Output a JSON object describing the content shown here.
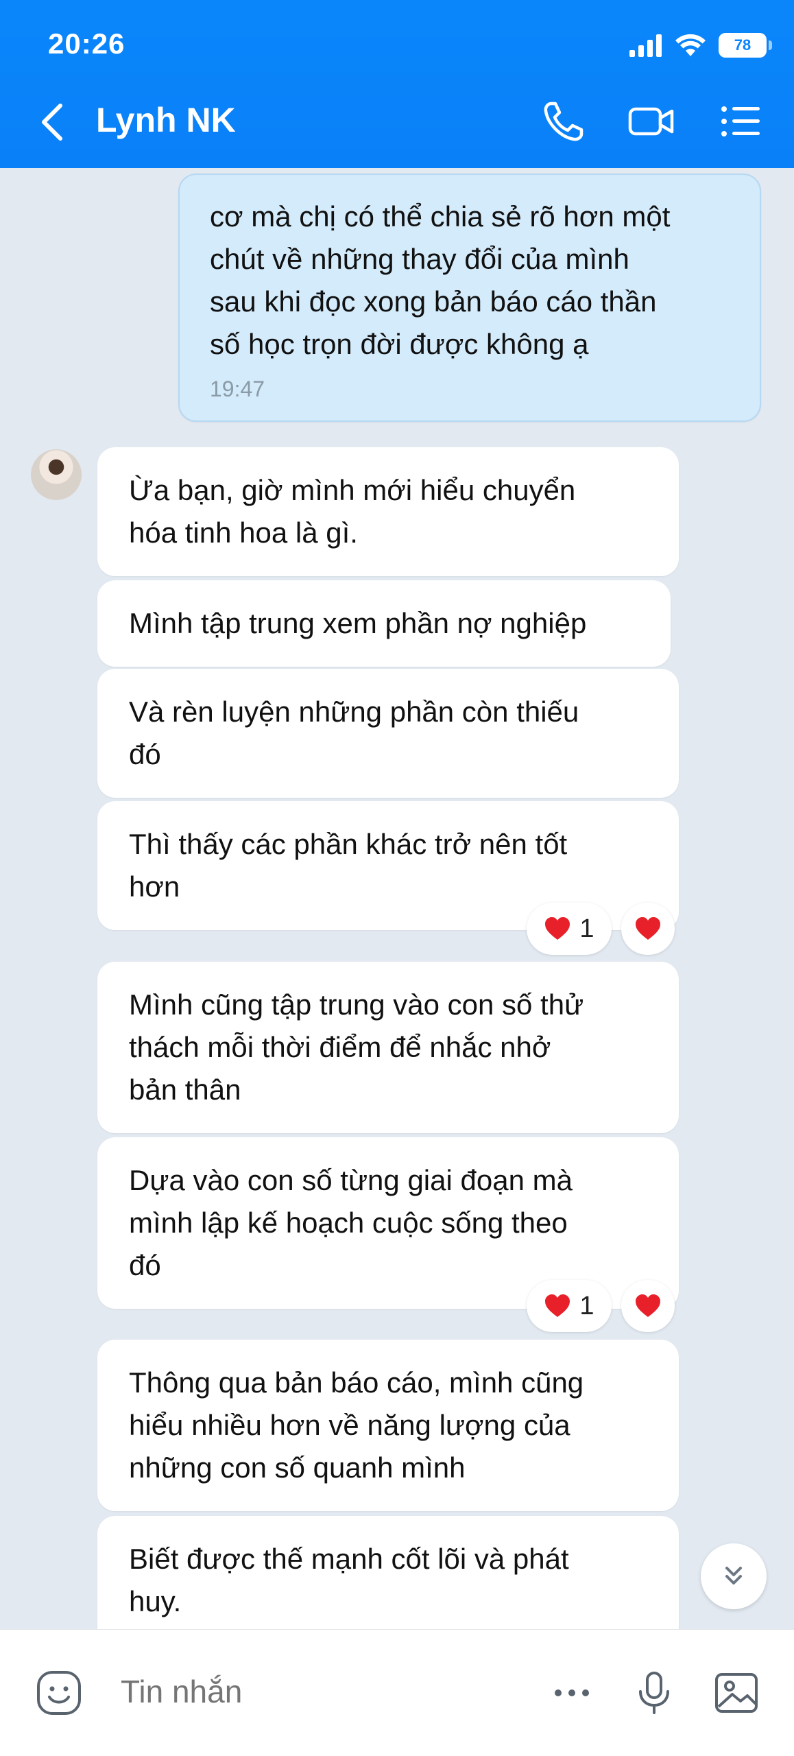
{
  "status_bar": {
    "time": "20:26",
    "battery": "78"
  },
  "header": {
    "title": "Lynh NK",
    "icons": [
      "back-arrow-icon",
      "phone-icon",
      "video-call-icon",
      "menu-list-icon"
    ]
  },
  "outgoing": {
    "lines": [
      "cơ mà chị có thể chia sẻ rõ hơn một",
      "chút về những thay đổi của mình",
      "sau khi đọc xong bản báo cáo thần",
      "số học trọn đời được không ạ"
    ],
    "time": "19:47"
  },
  "incoming": [
    {
      "lines": [
        "Ừa bạn, giờ mình mới hiểu chuyển",
        "hóa tinh hoa là gì."
      ]
    },
    {
      "lines": [
        "Mình tập trung xem phần nợ nghiệp"
      ]
    },
    {
      "lines": [
        "Và rèn luyện những phần còn thiếu",
        "đó"
      ]
    },
    {
      "lines": [
        "Thì thấy các phần khác trở nên tốt",
        "hơn"
      ],
      "reaction_count": "1"
    },
    {
      "lines": [
        "Mình cũng tập trung vào con số thử",
        "thách mỗi thời điểm để nhắc nhở",
        "bản thân"
      ]
    },
    {
      "lines": [
        "Dựa vào con số từng giai đoạn mà",
        "mình lập kế hoạch cuộc sống theo",
        "đó"
      ],
      "reaction_count": "1"
    },
    {
      "lines": [
        "Thông qua bản báo cáo, mình cũng",
        "hiểu nhiều hơn về năng lượng của",
        "những con số quanh mình"
      ]
    },
    {
      "lines": [
        "Biết được thế mạnh cốt lõi và phát",
        "huy."
      ]
    }
  ],
  "composer": {
    "placeholder": "Tin nhắn",
    "icons": [
      "sticker-icon",
      "more-icon",
      "microphone-icon",
      "image-icon"
    ]
  },
  "colors": {
    "header": "#0a84ff",
    "chat_bg": "#e2e9f1",
    "outgoing_bubble": "#d4ebfb",
    "reaction_heart": "#e8202a"
  }
}
